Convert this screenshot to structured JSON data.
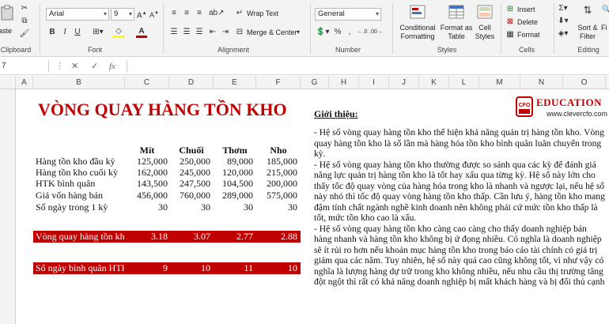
{
  "ribbon": {
    "clipboard": {
      "paste_label": "aste",
      "group_label": "Clipboard"
    },
    "font": {
      "font_name": "Arial",
      "font_size": "9",
      "group_label": "Font"
    },
    "alignment": {
      "wrap_text": "Wrap Text",
      "merge_center": "Merge & Center",
      "group_label": "Alignment"
    },
    "number": {
      "format": "General",
      "group_label": "Number"
    },
    "styles": {
      "conditional_formatting": [
        "Conditional",
        "Formatting"
      ],
      "format_as_table": [
        "Format as",
        "Table"
      ],
      "cell_styles": [
        "Cell",
        "Styles"
      ],
      "group_label": "Styles"
    },
    "cells": {
      "insert": "Insert",
      "delete": "Delete",
      "format": "Format",
      "group_label": "Cells"
    },
    "editing": {
      "sort_filter": [
        "Sort &",
        "Filter"
      ],
      "find_select": "Fi",
      "group_label": "Editing"
    }
  },
  "formula_bar": {
    "name_box": "7",
    "fx": "fx",
    "cancel": "✕",
    "enter": "✓"
  },
  "columns": [
    "A",
    "B",
    "C",
    "D",
    "E",
    "F",
    "G",
    "H",
    "I",
    "J",
    "K",
    "L",
    "M",
    "N",
    "O"
  ],
  "table": {
    "title": "VÒNG QUAY HÀNG TỒN KHO",
    "headers": [
      "Mít",
      "Chuối",
      "Thơm",
      "Nho"
    ],
    "rows": [
      {
        "label": "Hàng tồn kho đầu kỳ",
        "values": [
          "125,000",
          "250,000",
          "89,000",
          "185,000"
        ]
      },
      {
        "label": "Hàng tồn kho cuối kỳ",
        "values": [
          "162,000",
          "245,000",
          "120,000",
          "215,000"
        ]
      },
      {
        "label": "HTK bình quân",
        "values": [
          "143,500",
          "247,500",
          "104,500",
          "200,000"
        ]
      },
      {
        "label": "Giá vốn hàng bán",
        "values": [
          "456,000",
          "760,000",
          "289,000",
          "575,000"
        ]
      },
      {
        "label": "Số ngày trong 1 kỳ",
        "values": [
          "30",
          "30",
          "30",
          "30"
        ]
      }
    ],
    "turnover": {
      "label": "Vòng quay hàng tồn kho",
      "values": [
        "3.18",
        "3.07",
        "2.77",
        "2.88"
      ]
    },
    "days": {
      "label": "Số ngày bình quân HTK",
      "values": [
        "9",
        "10",
        "11",
        "10"
      ]
    }
  },
  "intro": {
    "title": "Giới thiệu:",
    "paragraphs": [
      "- Hệ số vòng quay hàng tồn kho thể hiện khả năng quản trị hàng tồn kho. Vòng quay hàng tồn kho là số lần mà hàng hóa tồn kho bình quân luân chuyển trong kỳ.",
      "- Hệ số vòng quay hàng tồn kho thường được so sánh qua các kỳ để đánh giá năng lực quản trị hàng tồn kho là tốt hay xấu qua từng kỳ. Hệ số này lớn cho thấy tốc độ quay vòng của hàng hóa trong kho là nhanh và ngược lại, nếu hệ số này nhỏ thì tốc độ quay vòng hàng tồn kho thấp. Cần lưu ý, hàng tồn kho mang đậm tính chất ngành nghề kinh doanh nên không phải cứ mức tồn kho thấp là tốt, mức tồn kho cao là xấu.",
      "- Hệ số vòng quay hàng tồn kho càng cao càng cho thấy doanh nghiệp bán hàng nhanh và hàng tồn kho không bị ứ đọng nhiều. Có nghĩa là doanh nghiệp sẽ ít rủi ro hơn nếu khoản mục hàng tồn kho trong báo cáo tài chính có giá trị giảm qua các năm. Tuy nhiên, hệ số này quá cao cũng không tốt, vì như vậy có nghĩa là lượng hàng dự trữ trong kho không nhiều, nếu nhu cầu thị trường tăng đột ngột thì rất có khả năng doanh nghiệp bị mất khách hàng và bị đối thủ cạnh"
    ]
  },
  "logo": {
    "badge": "CFO",
    "brand": "EDUCATION",
    "url": "www.clevercfo.com"
  },
  "colors": {
    "accent_red": "#c00000",
    "ribbon_bg": "#f3f3f3"
  }
}
